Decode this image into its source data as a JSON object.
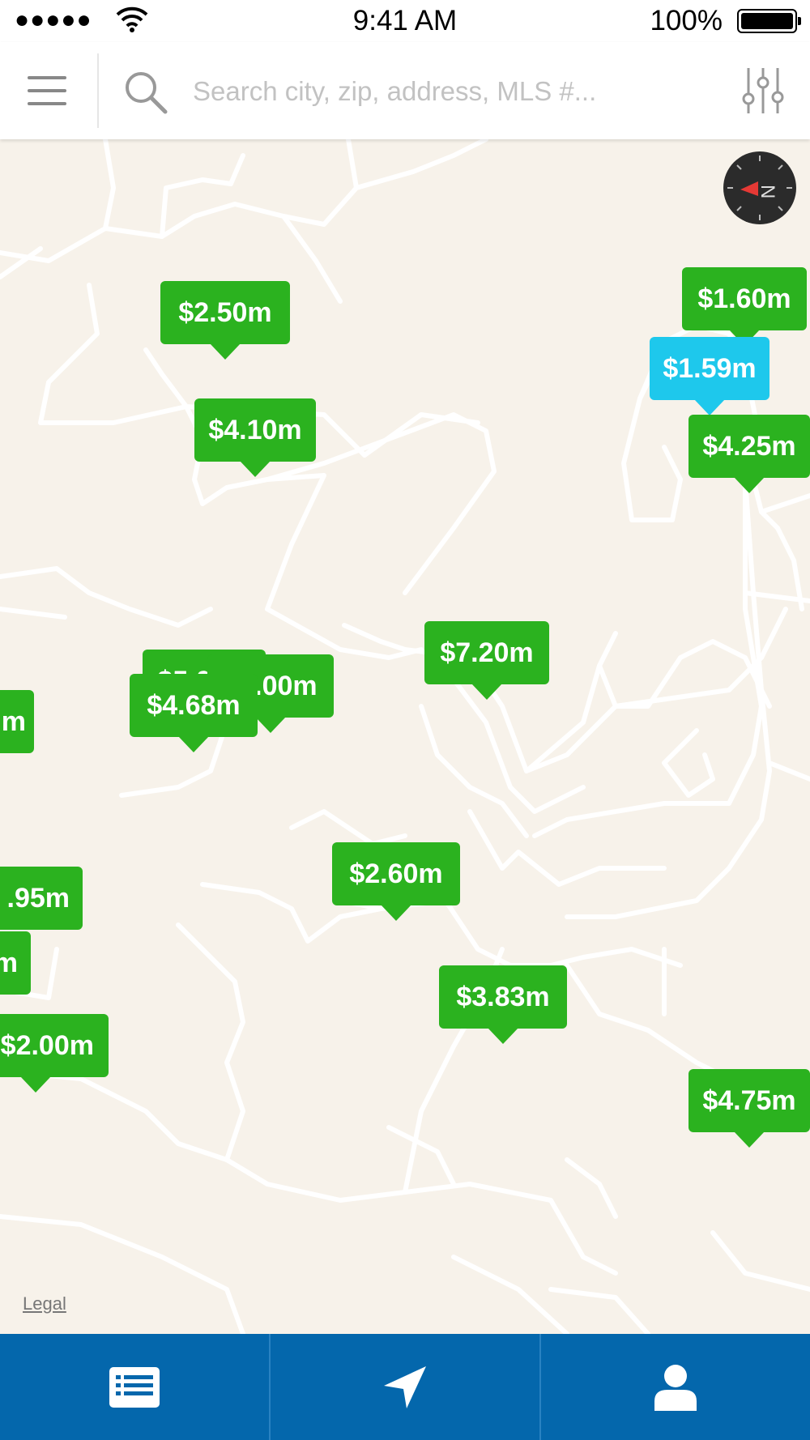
{
  "status_bar": {
    "signal": "●●●●●",
    "time": "9:41 AM",
    "battery": "100%"
  },
  "search": {
    "placeholder": "Search city, zip, address, MLS #..."
  },
  "map": {
    "pins": [
      {
        "label": "$2.50m",
        "selected": false
      },
      {
        "label": "$4.10m",
        "selected": false
      },
      {
        "label": "$1.60m",
        "selected": false
      },
      {
        "label": "$1.59m",
        "selected": true
      },
      {
        "label": "$4.25m",
        "selected": false
      },
      {
        "label": "$7.20m",
        "selected": false
      },
      {
        "label": "$5.00m",
        "selected": false
      },
      {
        "label": "$3.00m",
        "selected": false
      },
      {
        "label": "$4.68m",
        "selected": false
      },
      {
        "label": "m",
        "selected": false
      },
      {
        "label": ".95m",
        "selected": false
      },
      {
        "label": "m",
        "selected": false
      },
      {
        "label": "$2.60m",
        "selected": false
      },
      {
        "label": "$3.83m",
        "selected": false
      },
      {
        "label": "$2.00m",
        "selected": false
      },
      {
        "label": "$4.75m",
        "selected": false
      }
    ],
    "legal": "Legal"
  },
  "tabs": [
    {
      "name": "list",
      "icon": "list-icon"
    },
    {
      "name": "nearby",
      "icon": "location-arrow-icon"
    },
    {
      "name": "profile",
      "icon": "person-icon"
    }
  ],
  "colors": {
    "pin": "#2bb21f",
    "pin_selected": "#1ec8ec",
    "tab_bar": "#0467ac",
    "map_bg": "#f7f2ea"
  }
}
